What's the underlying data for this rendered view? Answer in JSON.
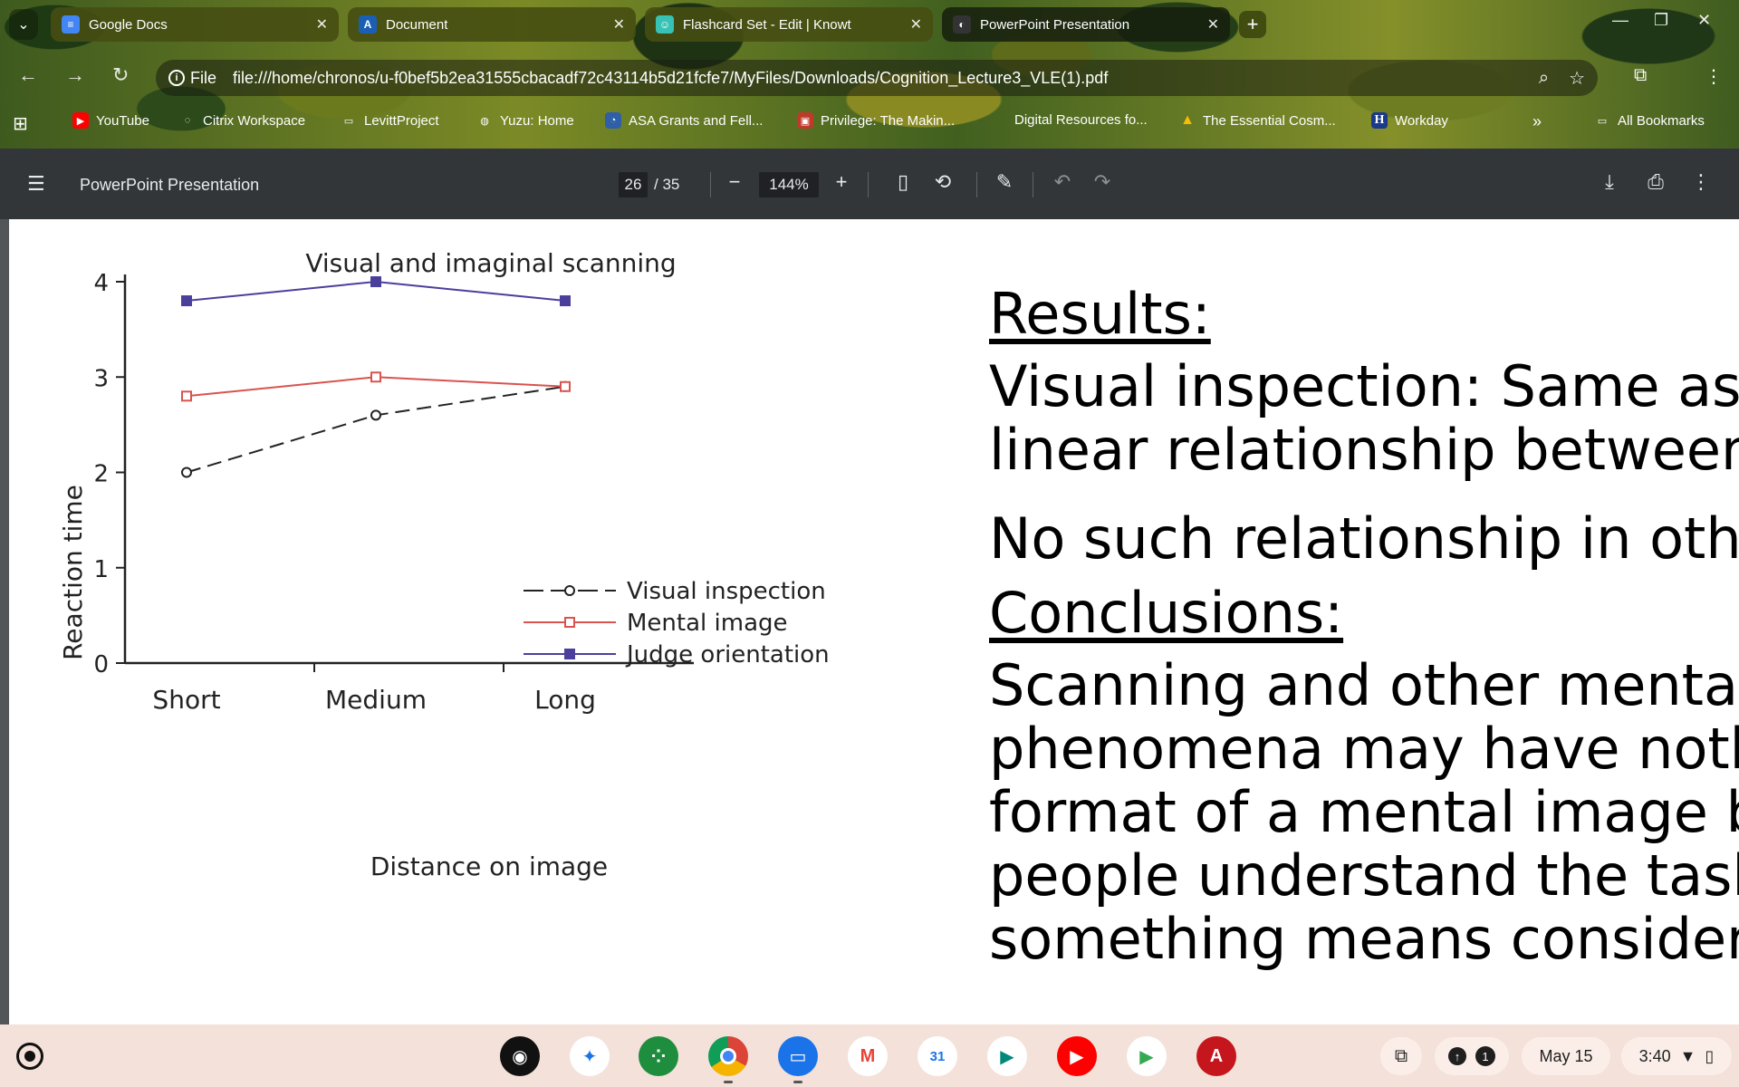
{
  "tabs": [
    {
      "title": "Google Docs",
      "icon": "google-docs-icon",
      "color": "#4285f4",
      "glyph": "≡"
    },
    {
      "title": "Document",
      "icon": "document-app-icon",
      "color": "#1a5fb4",
      "glyph": "A"
    },
    {
      "title": "Flashcard Set - Edit | Knowt",
      "icon": "knowt-icon",
      "color": "#36c2b4",
      "glyph": "☺"
    },
    {
      "title": "PowerPoint Presentation",
      "icon": "pdf-viewer-icon",
      "color": "#333333",
      "glyph": "◐"
    }
  ],
  "address": {
    "scheme_label": "File",
    "url": "file:///home/chronos/u-f0bef5b2ea31555cbacadf72c43114b5d21fcfe7/MyFiles/Downloads/Cognition_Lecture3_VLE(1).pdf"
  },
  "bookmarks": [
    {
      "label": "YouTube",
      "icon": "youtube-icon",
      "color": "#ff0000"
    },
    {
      "label": "Citrix Workspace",
      "icon": "citrix-icon",
      "color": "#ffffff"
    },
    {
      "label": "LevittProject",
      "icon": "folder-icon",
      "color": "#ffffff"
    },
    {
      "label": "Yuzu: Home",
      "icon": "globe-icon",
      "color": "#ffffff"
    },
    {
      "label": "ASA Grants and Fell...",
      "icon": "asa-icon",
      "color": "#2f5fa8"
    },
    {
      "label": "Privilege: The Makin...",
      "icon": "book-icon",
      "color": "#c0392b"
    },
    {
      "label": "Digital Resources fo...",
      "icon": "",
      "color": ""
    },
    {
      "label": "The Essential Cosm...",
      "icon": "drive-icon",
      "color": "#fbbc04"
    },
    {
      "label": "Workday",
      "icon": "workday-icon",
      "color": "#1a3a8a"
    }
  ],
  "all_bookmarks_label": "All Bookmarks",
  "pdf_toolbar": {
    "title": "PowerPoint Presentation",
    "page_current": "26",
    "page_total": "/ 35",
    "zoom": "144%"
  },
  "slide": {
    "results_heading": "Results:",
    "results_lines": [
      "Visual inspection: Same as K",
      "linear relationship between"
    ],
    "no_such_line": "No such relationship in othe",
    "conclusions_heading": "Conclusions:",
    "conclusion_lines": [
      "Scanning and other mental",
      "phenomena may have nothi",
      "format of a mental image bu",
      "people understand the task",
      "something means consideri"
    ]
  },
  "chart_data": {
    "type": "line",
    "title": "Visual and imaginal scanning",
    "xlabel": "Distance on image",
    "ylabel": "Reaction time",
    "categories": [
      "Short",
      "Medium",
      "Long"
    ],
    "ylim": [
      0,
      4
    ],
    "yticks": [
      0,
      1,
      2,
      3,
      4
    ],
    "legend_position": "lower-right",
    "series": [
      {
        "name": "Visual inspection",
        "values": [
          2.0,
          2.6,
          2.9
        ],
        "color": "#222222",
        "marker": "circle",
        "dash": true
      },
      {
        "name": "Mental image",
        "values": [
          2.8,
          3.0,
          2.9
        ],
        "color": "#d9534f",
        "marker": "square-open",
        "dash": false
      },
      {
        "name": "Judge orientation",
        "values": [
          3.8,
          4.0,
          3.8
        ],
        "color": "#4b3f9c",
        "marker": "square-filled",
        "dash": false
      }
    ]
  },
  "shelf": {
    "apps": [
      {
        "name": "podcasts-app-icon",
        "color": "#111111",
        "glyph": "◉"
      },
      {
        "name": "gemini-app-icon",
        "color": "#ffffff",
        "glyph": "✦"
      },
      {
        "name": "apps-grid-app-icon",
        "color": "#1e8e3e",
        "glyph": "⁘"
      },
      {
        "name": "chrome-app-icon",
        "color": "#db4437",
        "glyph": "◎"
      },
      {
        "name": "files-app-icon",
        "color": "#1a73e8",
        "glyph": "▭"
      },
      {
        "name": "gmail-app-icon",
        "color": "#ffffff",
        "glyph": "M"
      },
      {
        "name": "calendar-app-icon",
        "color": "#ffffff",
        "glyph": "31"
      },
      {
        "name": "meet-app-icon",
        "color": "#ffffff",
        "glyph": "▶"
      },
      {
        "name": "youtube-app-icon",
        "color": "#ff0000",
        "glyph": "▶"
      },
      {
        "name": "play-store-app-icon",
        "color": "#ffffff",
        "glyph": "▶"
      },
      {
        "name": "acrobat-app-icon",
        "color": "#c4161c",
        "glyph": "A"
      }
    ],
    "notification_count": "1",
    "date": "May 15",
    "time": "3:40"
  }
}
